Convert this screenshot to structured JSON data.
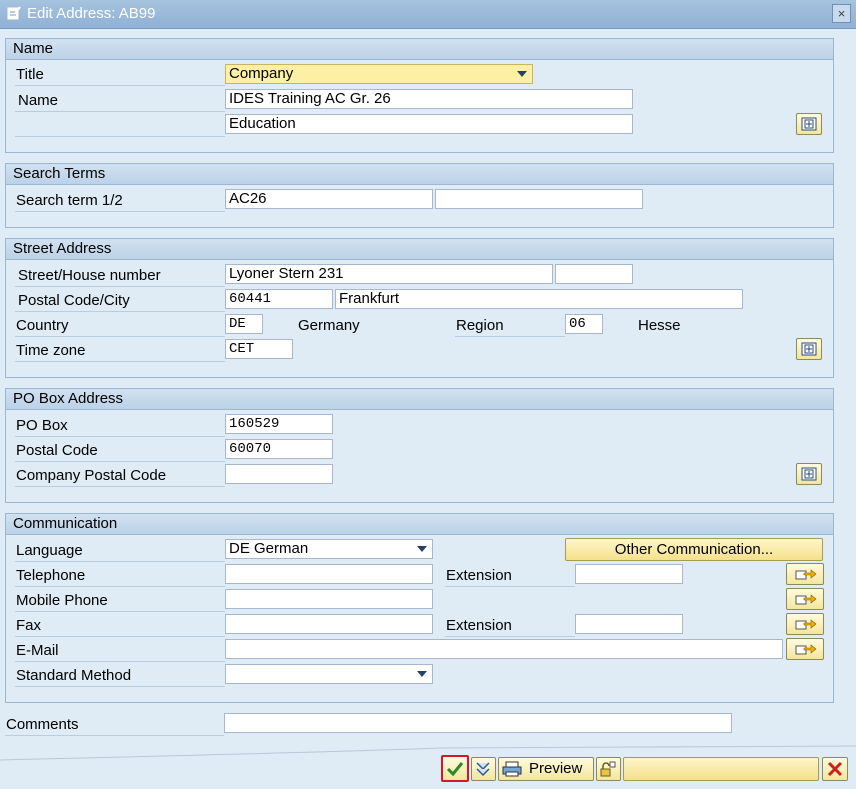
{
  "window": {
    "title": "Edit Address:  AB99",
    "close_label": "×"
  },
  "name_section": {
    "header": "Name",
    "title_label": "Title",
    "title_value": "Company",
    "name_label": "Name",
    "name1_value": "IDES Training AC Gr. 26",
    "name2_value": "Education"
  },
  "search_section": {
    "header": "Search Terms",
    "label": "Search term 1/2",
    "term1": "AC26",
    "term2": ""
  },
  "street_section": {
    "header": "Street Address",
    "street_label": "Street/House number",
    "street_value": "Lyoner Stern 231",
    "house_value": "",
    "postal_label": "Postal Code/City",
    "postal_value": "60441",
    "city_value": "Frankfurt",
    "country_label": "Country",
    "country_code": "DE",
    "country_name": "Germany",
    "region_label": "Region",
    "region_code": "06",
    "region_name": "Hesse",
    "tz_label": "Time zone",
    "tz_value": "CET"
  },
  "pobox_section": {
    "header": "PO Box Address",
    "pobox_label": "PO Box",
    "pobox_value": "160529",
    "postal_label": "Postal Code",
    "postal_value": "60070",
    "company_postal_label": "Company Postal Code",
    "company_postal_value": ""
  },
  "comm_section": {
    "header": "Communication",
    "language_label": "Language",
    "language_value": "DE German",
    "other_comm_label": "Other Communication...",
    "telephone_label": "Telephone",
    "telephone_value": "",
    "extension_label": "Extension",
    "tel_ext_value": "",
    "mobile_label": "Mobile Phone",
    "mobile_value": "",
    "fax_label": "Fax",
    "fax_value": "",
    "fax_ext_label": "Extension",
    "fax_ext_value": "",
    "email_label": "E-Mail",
    "email_value": "",
    "std_method_label": "Standard Method",
    "std_method_value": ""
  },
  "comments": {
    "label": "Comments",
    "value": ""
  },
  "footer": {
    "preview_label": "Preview"
  }
}
